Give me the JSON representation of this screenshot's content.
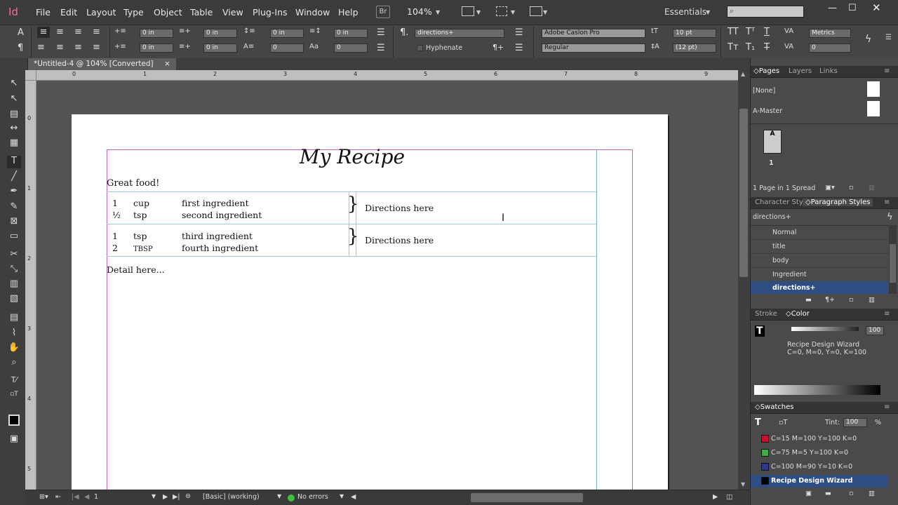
{
  "app": {
    "logo": "Id",
    "zoom": "104%",
    "bridge": "Br",
    "workspace": "Essentials"
  },
  "menu": [
    "File",
    "Edit",
    "Layout",
    "Type",
    "Object",
    "Table",
    "View",
    "Plug-Ins",
    "Window",
    "Help"
  ],
  "control": {
    "indent_left": "0 in",
    "indent_right": "0 in",
    "first_indent": "0 in",
    "last_indent": "0 in",
    "space_before": "0 in",
    "space_after": "0 in",
    "drop_lines": "0",
    "drop_chars": "0",
    "para_style": "directions+",
    "hyphenate": "Hyphenate",
    "font": "Adobe Caslon Pro",
    "font_style": "Regular",
    "size": "10 pt",
    "leading": "(12 pt)",
    "kerning": "Metrics",
    "tracking": "0"
  },
  "tab": {
    "title": "*Untitled-4 @ 104% [Converted]",
    "close": "×"
  },
  "rulers": {
    "h": [
      "0",
      "1",
      "2",
      "3",
      "4",
      "5",
      "6",
      "7",
      "8",
      "9"
    ],
    "v": [
      "0",
      "1",
      "2",
      "3",
      "4",
      "5"
    ]
  },
  "document": {
    "title": "My Recipe",
    "intro": "Great food!",
    "rows": [
      {
        "ingredients": [
          [
            "1",
            "cup",
            "first ingredient"
          ],
          [
            "½",
            "tsp",
            "second ingredient"
          ]
        ],
        "brace": "}",
        "direction": "Directions here"
      },
      {
        "ingredients": [
          [
            "1",
            "tsp",
            "third ingredient"
          ],
          [
            "2",
            "TBSP",
            "fourth ingredient"
          ]
        ],
        "brace": "}",
        "direction": "Directions here"
      }
    ],
    "detail": "Detail here..."
  },
  "status": {
    "page": "1",
    "profile": "[Basic] (working)",
    "errors": "No errors"
  },
  "pages_panel": {
    "tabs": [
      "Pages",
      "Layers",
      "Links"
    ],
    "masters": [
      "[None]",
      "A-Master"
    ],
    "thumb_letter": "A",
    "thumb_num": "1",
    "footer": "1 Page in 1 Spread"
  },
  "styles_panel": {
    "tabs": [
      "Character Sty",
      "Paragraph Styles"
    ],
    "current": "directions+",
    "items": [
      "Normal",
      "title",
      "body",
      "Ingredient",
      "directions+"
    ]
  },
  "color_panel": {
    "tabs": [
      "Stroke",
      "Color"
    ],
    "tint": "100",
    "swatch_name": "Recipe Design Wizard",
    "cmyk": "C=0, M=0, Y=0, K=100"
  },
  "swatches_panel": {
    "title": "Swatches",
    "tint_label": "Tint:",
    "tint": "100",
    "pct": "%",
    "items": [
      {
        "name": "C=15 M=100 Y=100 K=0",
        "color": "#c8102e"
      },
      {
        "name": "C=75 M=5 Y=100 K=0",
        "color": "#3fae49"
      },
      {
        "name": "C=100 M=90 Y=10 K=0",
        "color": "#2b3a8f"
      },
      {
        "name": "Recipe Design Wizard",
        "color": "#000000"
      }
    ]
  }
}
